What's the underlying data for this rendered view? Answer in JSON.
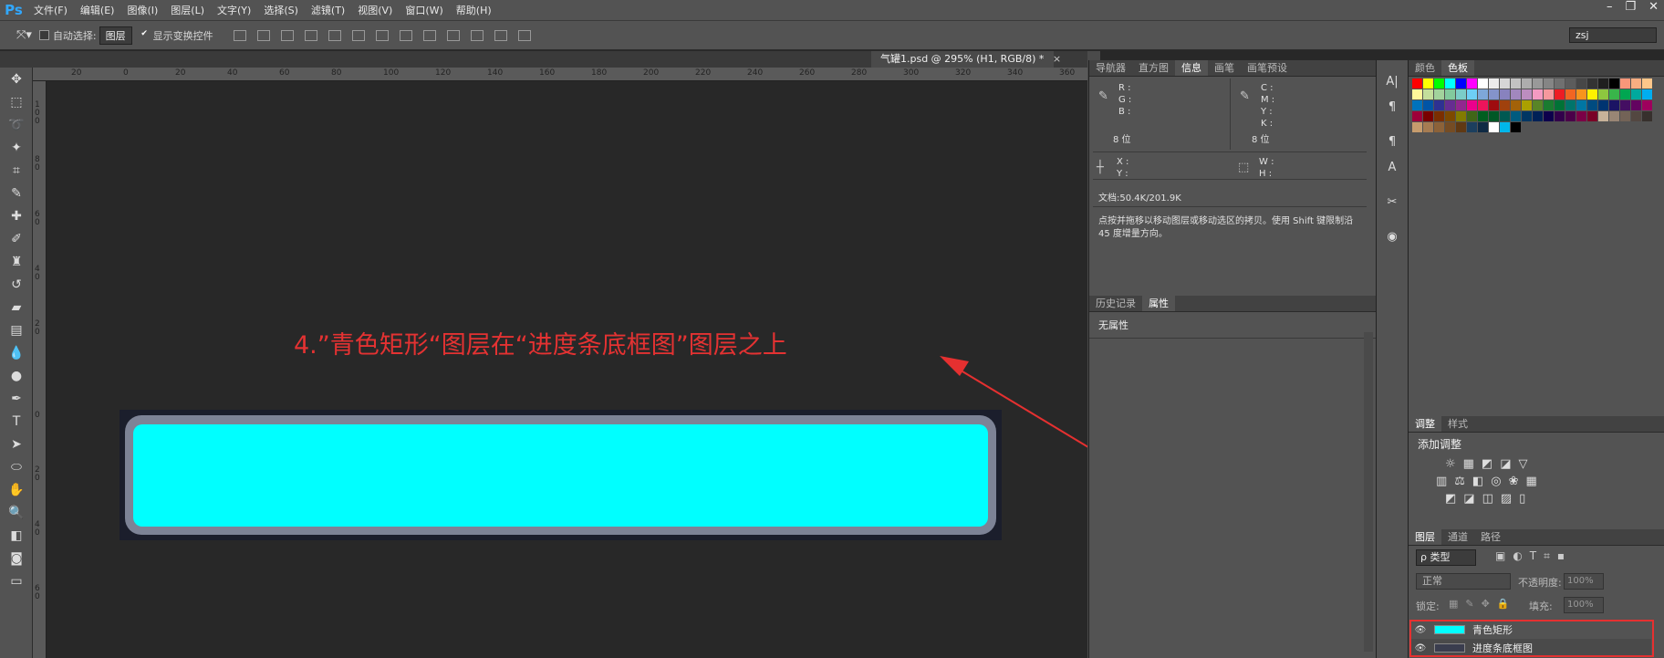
{
  "app": {
    "logo": "Ps"
  },
  "menu": [
    "文件(F)",
    "编辑(E)",
    "图像(I)",
    "图层(L)",
    "文字(Y)",
    "选择(S)",
    "滤镜(T)",
    "视图(V)",
    "窗口(W)",
    "帮助(H)"
  ],
  "options": {
    "auto_select_label": "自动选择:",
    "auto_select_value": "图层",
    "show_transform_label": "显示变换控件",
    "workspace": "zsj"
  },
  "document": {
    "tab_title": "气罐1.psd @ 295% (H1, RGB/8) *"
  },
  "ruler_top": [
    "20",
    "0",
    "20",
    "40",
    "60",
    "80",
    "100",
    "120",
    "140",
    "160",
    "180",
    "200",
    "220",
    "240",
    "260",
    "280",
    "300",
    "320",
    "340",
    "360"
  ],
  "ruler_left": [
    "100",
    "80",
    "60",
    "40",
    "20",
    "0",
    "20",
    "40",
    "60"
  ],
  "annotation": "4.”青色矩形“图层在“进度条底框图”图层之上",
  "colors": {
    "cyan": "#00ffff",
    "frame_grey": "#7d8396",
    "frame_dark": "#1b1e2c",
    "annot_red": "#e43232"
  },
  "info_panel": {
    "tabs": [
      "导航器",
      "直方图",
      "信息",
      "画笔",
      "画笔预设"
    ],
    "rgb_labels": [
      "R :",
      "G :",
      "B :"
    ],
    "cmyk_labels": [
      "C :",
      "M :",
      "Y :",
      "K :"
    ],
    "bits_left": "8 位",
    "bits_right": "8 位",
    "xy_labels": [
      "X :",
      "Y :"
    ],
    "wh_labels": [
      "W :",
      "H :"
    ],
    "doc_size": "文档:50.4K/201.9K",
    "hint": "点按并拖移以移动图层或移动选区的拷贝。使用 Shift 键限制沿 45 度增量方向。"
  },
  "properties_panel": {
    "tabs": [
      "历史记录",
      "属性"
    ],
    "text": "无属性"
  },
  "swatch_panel": {
    "tabs": [
      "颜色",
      "色板"
    ]
  },
  "adjust_panel": {
    "tabs": [
      "调整",
      "样式"
    ],
    "title": "添加调整"
  },
  "layers_panel": {
    "tabs": [
      "图层",
      "通道",
      "路径"
    ],
    "filter": "ρ 类型",
    "blend": "正常",
    "opacity_label": "不透明度:",
    "opacity_value": "100%",
    "lock_label": "锁定:",
    "fill_label": "填充:",
    "fill_value": "100%",
    "layers": [
      {
        "name": "青色矩形",
        "thumb": "#00ffff"
      },
      {
        "name": "进度条底框图",
        "thumb": "#3a3d4e"
      }
    ]
  }
}
